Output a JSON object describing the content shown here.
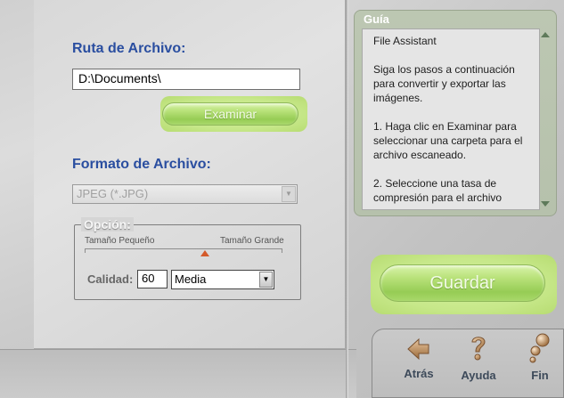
{
  "main": {
    "file_path": {
      "label": "Ruta de Archivo:",
      "value": "D:\\Documents\\",
      "browse_label": "Examinar"
    },
    "file_format": {
      "label": "Formato de Archivo:",
      "selected": "JPEG (*.JPG)"
    },
    "option": {
      "legend": "Opción:",
      "scale_min_label": "Tamaño Pequeño",
      "scale_max_label": "Tamaño Grande",
      "quality_label": "Calidad:",
      "quality_value": "60",
      "quality_preset": "Media"
    },
    "save_label": "Guardar"
  },
  "guide": {
    "title": "Guía",
    "paragraphs": [
      "File Assistant",
      "Siga los pasos a continuación para convertir y exportar las imágenes.",
      "1. Haga clic en Examinar para seleccionar una carpeta para el archivo escaneado.",
      "2. Seleccione una tasa de compresión para el archivo"
    ]
  },
  "nav": {
    "back_label": "Atrás",
    "help_label": "Ayuda",
    "exit_label": "Fin"
  },
  "colors": {
    "section_label": "#2a4ea0",
    "accent_green": "#96cc55",
    "pointer": "#d45a2a"
  }
}
